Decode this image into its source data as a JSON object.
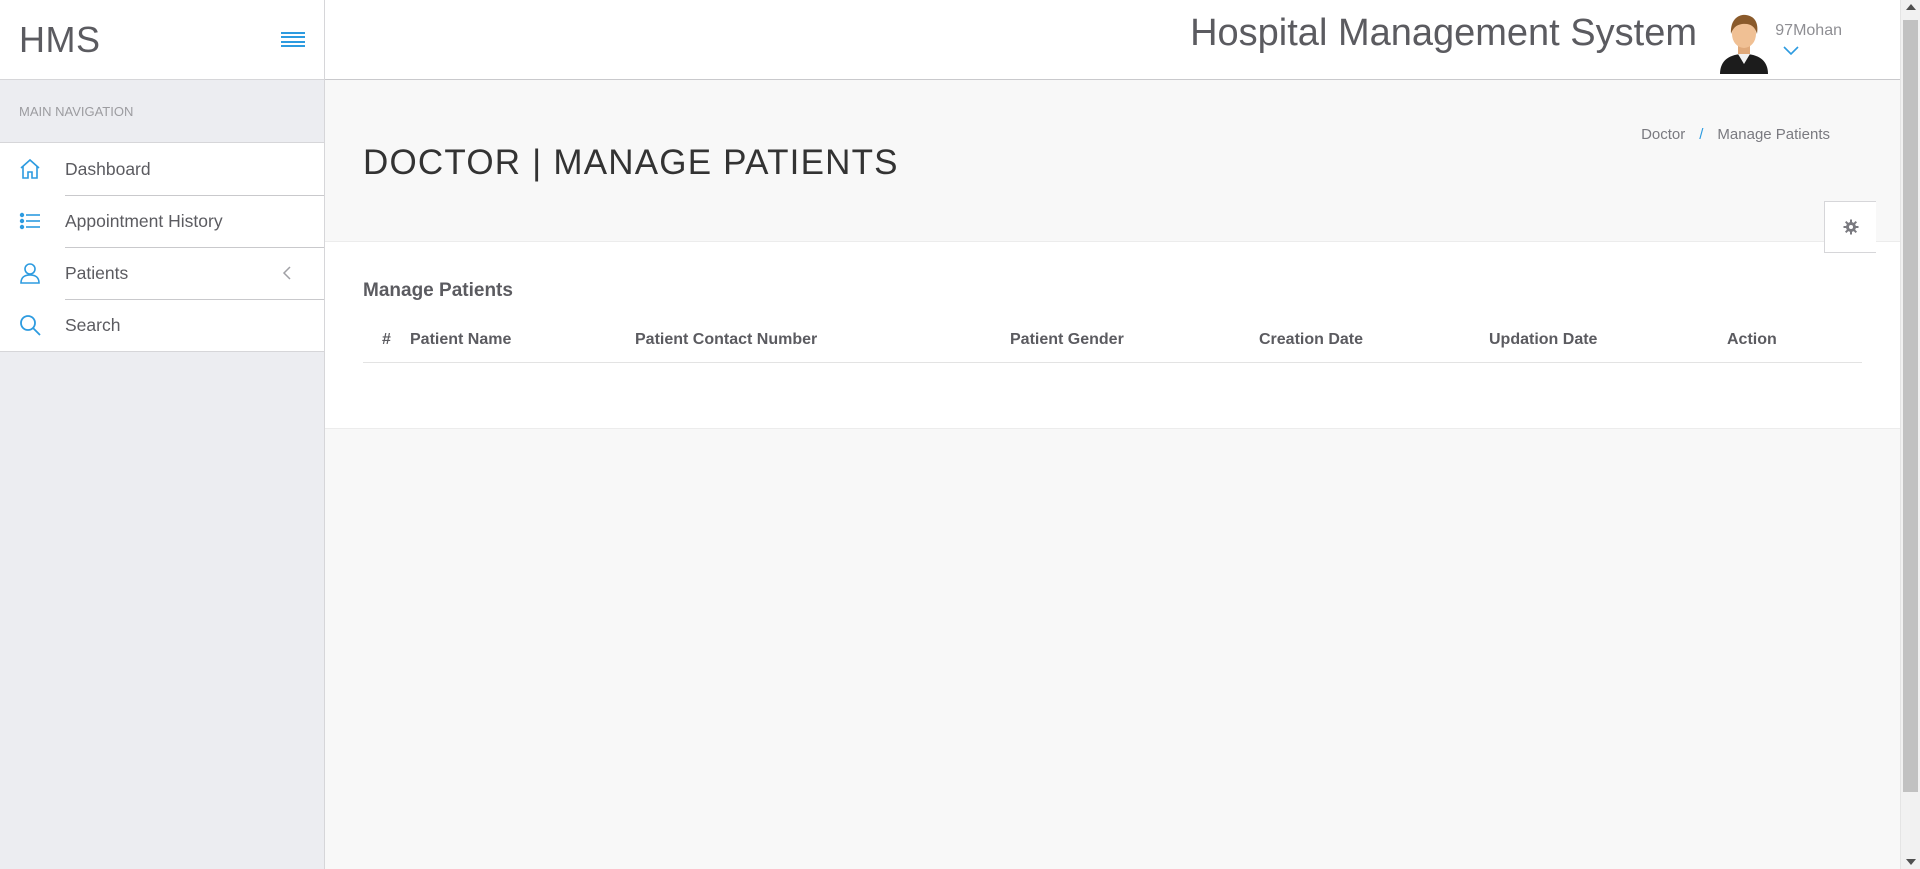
{
  "brand": {
    "name": "HMS"
  },
  "sidebar": {
    "header": "MAIN NAVIGATION",
    "items": [
      {
        "label": "Dashboard",
        "icon": "home-icon"
      },
      {
        "label": "Appointment History",
        "icon": "list-icon"
      },
      {
        "label": "Patients",
        "icon": "user-icon"
      },
      {
        "label": "Search",
        "icon": "search-icon"
      }
    ]
  },
  "topbar": {
    "title": "Hospital Management System",
    "user_name": "97Mohan"
  },
  "page": {
    "title": "DOCTOR | MANAGE PATIENTS",
    "breadcrumb": [
      "Doctor",
      "/",
      "Manage Patients"
    ]
  },
  "panel": {
    "title_prefix": "Manage",
    "title_bold": "Patients"
  },
  "table": {
    "columns": [
      "#",
      "Patient Name",
      "Patient Contact Number",
      "Patient Gender",
      "Creation Date",
      "Updation Date",
      "Action"
    ],
    "rows": []
  },
  "colors": {
    "accent": "#2d9be0",
    "sidebar_bg": "#ecedf1",
    "text": "#5b5b60"
  }
}
